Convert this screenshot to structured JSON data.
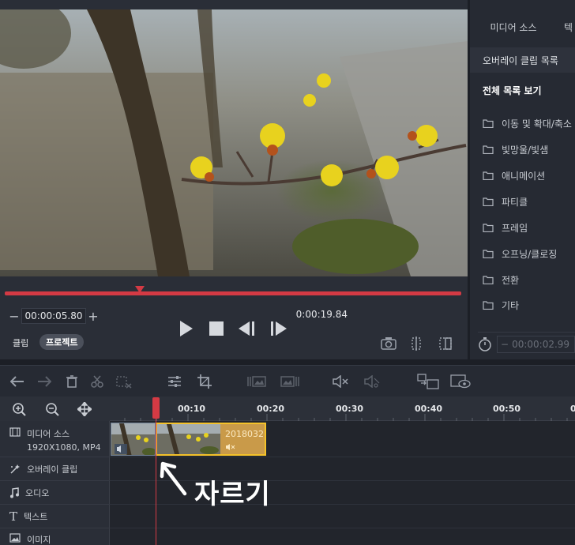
{
  "preview": {
    "current_time": "00:00:05.80",
    "total_time": "0:00:19.84",
    "progress_fraction": 0.29,
    "mode_clip": "클립",
    "mode_project": "프로젝트"
  },
  "right_panel": {
    "tab_media": "미디어 소스",
    "tab_2": "텍",
    "overlay_clip_list": "오버레이 클립 목록",
    "view_all": "전체 목록 보기",
    "folders": [
      "이동 및 확대/축소",
      "빛망울/빛샘",
      "애니메이션",
      "파티클",
      "프레임",
      "오프닝/클로징",
      "전환",
      "기타"
    ],
    "duration_value": "00:00:02.99"
  },
  "timeline": {
    "ticks": [
      "00:10",
      "00:20",
      "00:30",
      "00:40",
      "00:50",
      "0"
    ],
    "tracks": [
      {
        "label": "미디어 소스",
        "sub": "1920X1080, MP4"
      },
      {
        "label": "오버레이 클립"
      },
      {
        "label": "오디오"
      },
      {
        "label": "텍스트"
      },
      {
        "label": "이미지"
      }
    ],
    "clip_b_name": "2018032..."
  },
  "annotation": {
    "text": "자르기"
  },
  "colors": {
    "accent": "#d43a44",
    "selection": "#f4c22a",
    "panel": "#262a33"
  }
}
